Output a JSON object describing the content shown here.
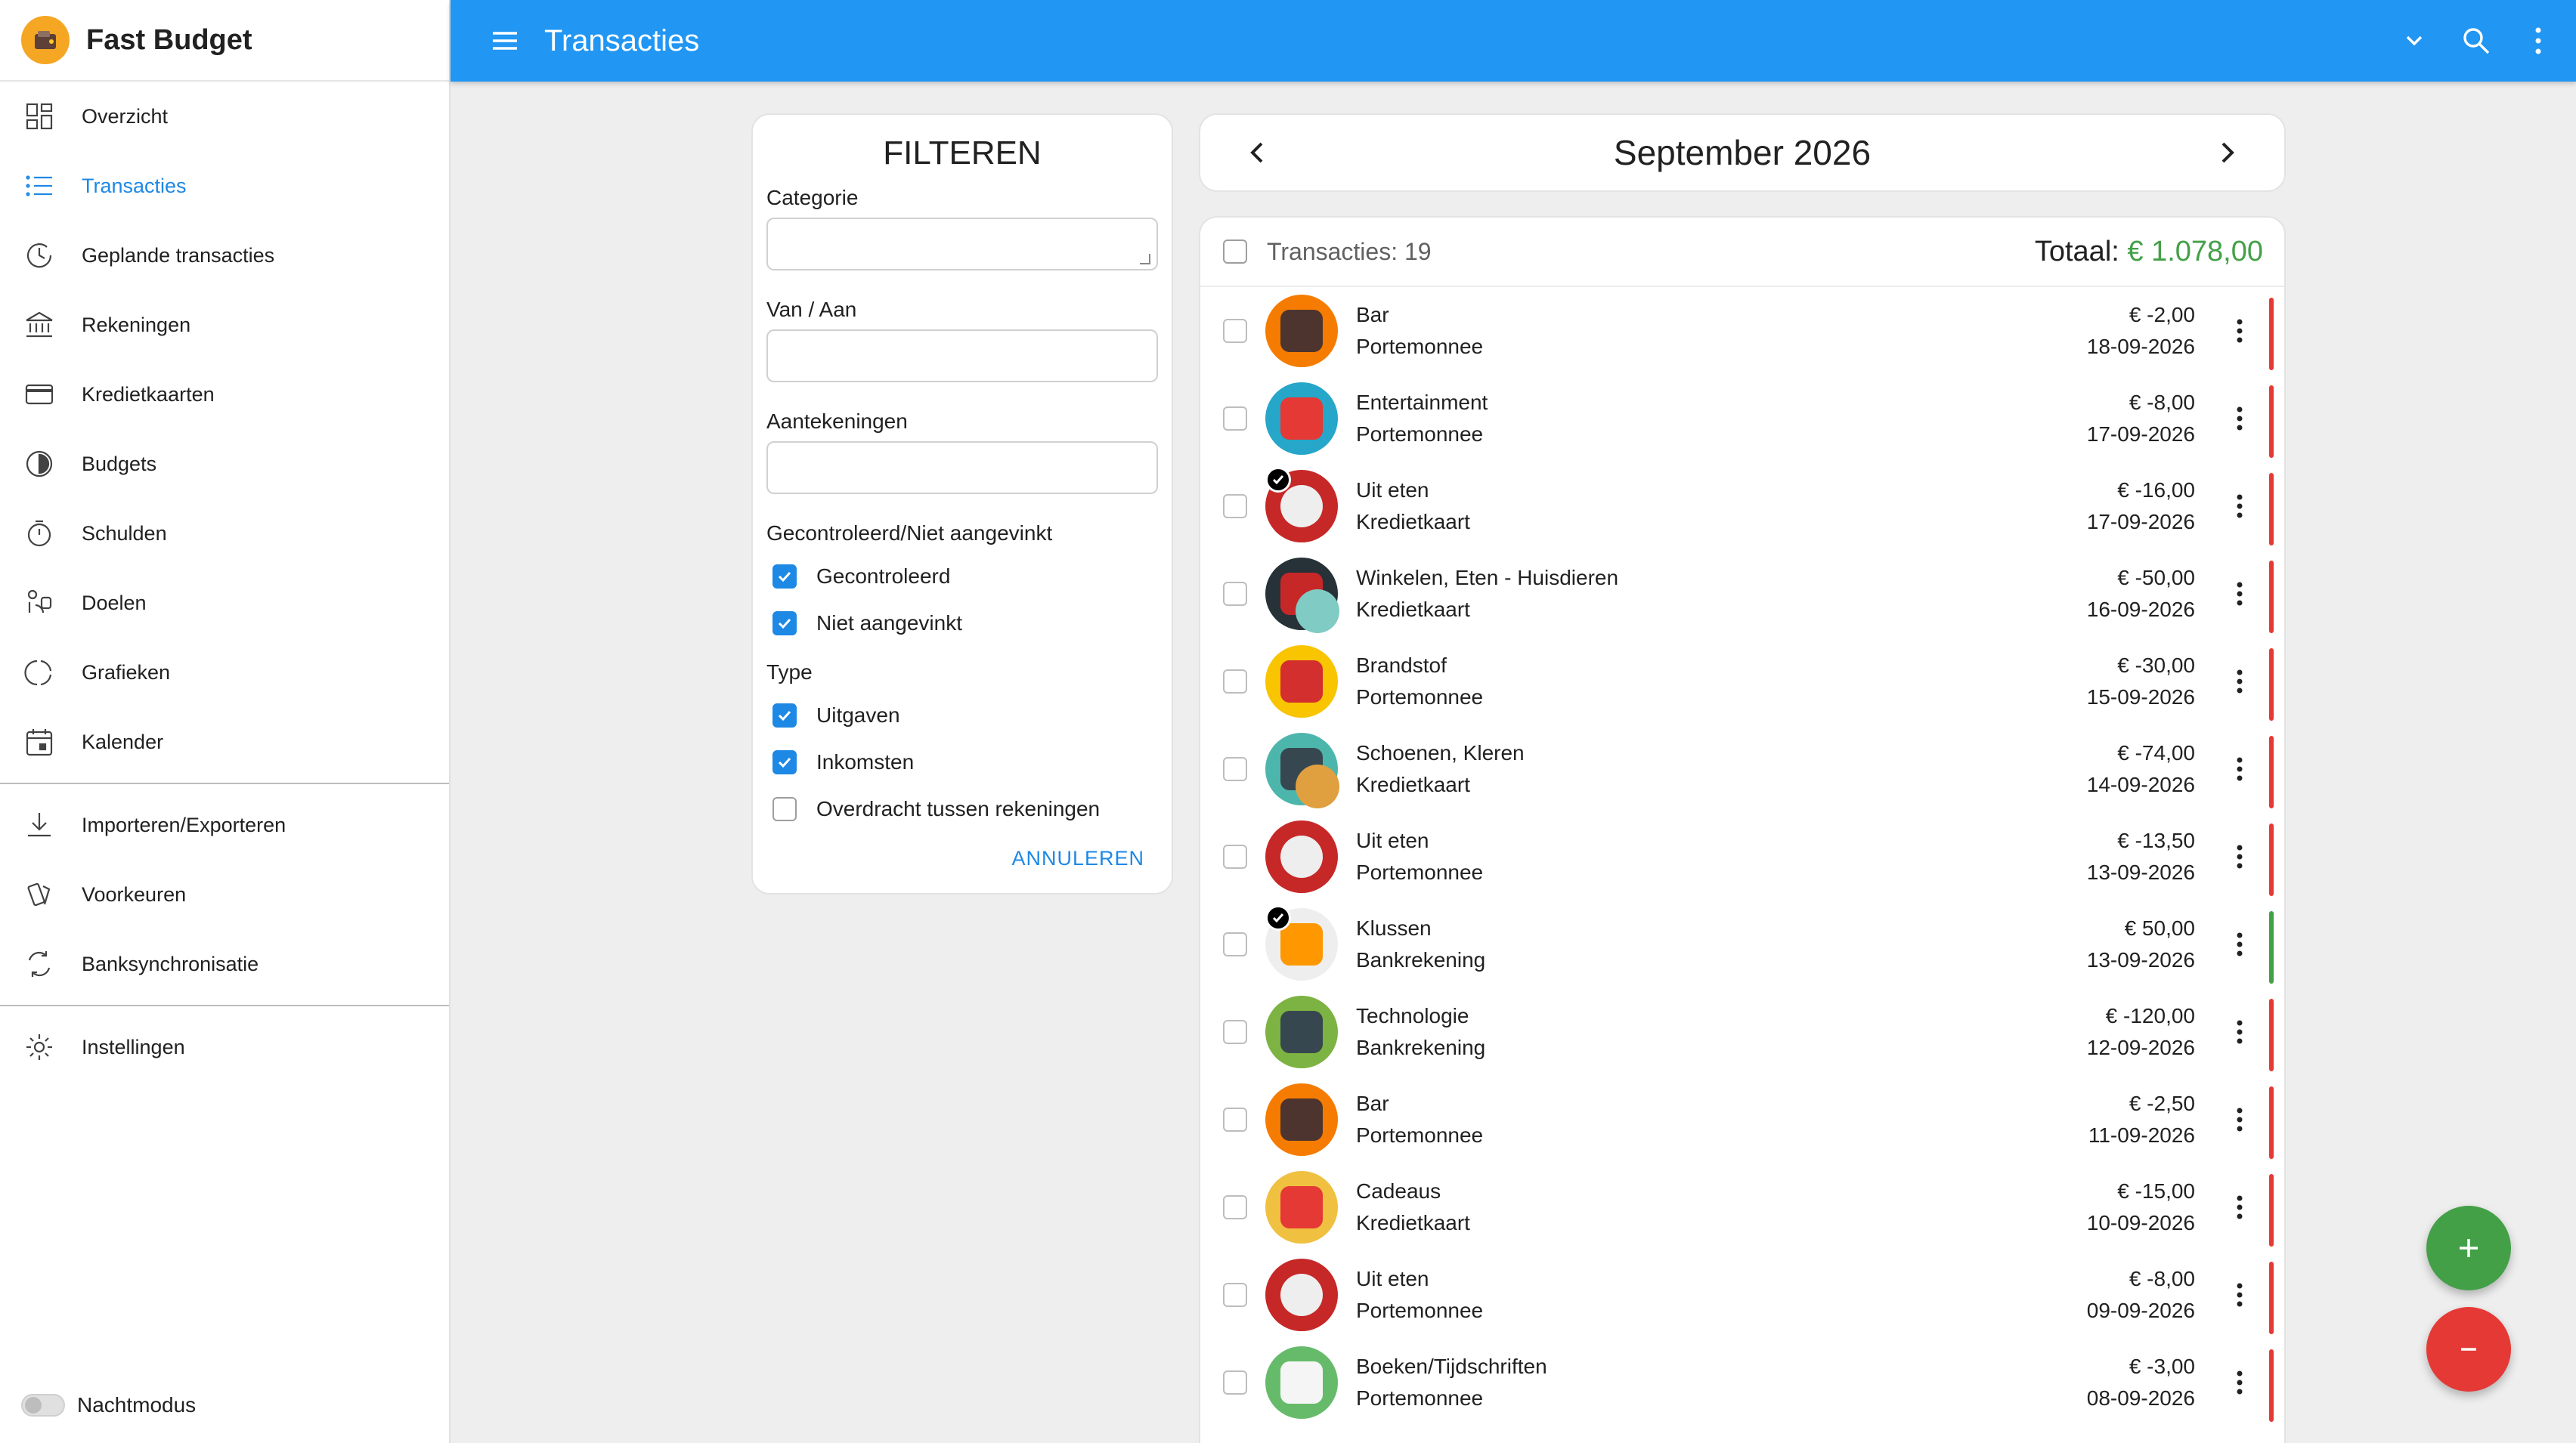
{
  "app": {
    "name": "Fast Budget",
    "accent": "#2196f3"
  },
  "sidebar": {
    "items": [
      {
        "label": "Overzicht",
        "icon": "dashboard-icon"
      },
      {
        "label": "Transacties",
        "icon": "list-icon",
        "active": true
      },
      {
        "label": "Geplande transacties",
        "icon": "schedule-icon"
      },
      {
        "label": "Rekeningen",
        "icon": "bank-icon"
      },
      {
        "label": "Kredietkaarten",
        "icon": "credit-card-icon"
      },
      {
        "label": "Budgets",
        "icon": "pie-icon"
      },
      {
        "label": "Schulden",
        "icon": "timer-icon"
      },
      {
        "label": "Doelen",
        "icon": "goal-icon"
      },
      {
        "label": "Grafieken",
        "icon": "donut-icon"
      },
      {
        "label": "Kalender",
        "icon": "calendar-icon"
      }
    ],
    "items2": [
      {
        "label": "Importeren/Exporteren",
        "icon": "download-icon"
      },
      {
        "label": "Voorkeuren",
        "icon": "preferences-icon"
      },
      {
        "label": "Banksynchronisatie",
        "icon": "sync-icon"
      }
    ],
    "items3": [
      {
        "label": "Instellingen",
        "icon": "settings-icon"
      }
    ],
    "night_mode": "Nachtmodus"
  },
  "topbar": {
    "title": "Transacties"
  },
  "filter": {
    "title": "FILTEREN",
    "category_label": "Categorie",
    "from_to_label": "Van / Aan",
    "notes_label": "Aantekeningen",
    "checked_section": "Gecontroleerd/Niet aangevinkt",
    "checked": "Gecontroleerd",
    "unchecked": "Niet aangevinkt",
    "type_section": "Type",
    "expenses": "Uitgaven",
    "income": "Inkomsten",
    "transfer": "Overdracht tussen rekeningen",
    "cancel": "ANNULEREN"
  },
  "month": {
    "title": "September 2026"
  },
  "list": {
    "count": "Transacties: 19",
    "total_label": "Totaal:",
    "total_value": "€ 1.078,00",
    "rows": [
      {
        "category": "Bar",
        "account": "Portemonnee",
        "amount": "€ -2,00",
        "date": "18-09-2026",
        "color": "#f57c00",
        "icon": "coffee-icon",
        "inner": "#4e342e",
        "type": "expense"
      },
      {
        "category": "Entertainment",
        "account": "Portemonnee",
        "amount": "€ -8,00",
        "date": "17-09-2026",
        "color": "#26a6c9",
        "icon": "party-hat-icon",
        "inner": "#e53935",
        "type": "expense"
      },
      {
        "category": "Uit eten",
        "account": "Kredietkaart",
        "amount": "€ -16,00",
        "date": "17-09-2026",
        "color": "#c62828",
        "icon": "plate-icon",
        "inner": "#eeeeee",
        "type": "expense",
        "checked": true
      },
      {
        "category": "Winkelen, Eten - Huisdieren",
        "account": "Kredietkaart",
        "amount": "€ -50,00",
        "date": "16-09-2026",
        "color": "#263238",
        "icon": "shopping-icon",
        "inner": "#c62828",
        "type": "expense",
        "sub": "#80cbc4"
      },
      {
        "category": "Brandstof",
        "account": "Portemonnee",
        "amount": "€ -30,00",
        "date": "15-09-2026",
        "color": "#f9c400",
        "icon": "fuel-icon",
        "inner": "#d32f2f",
        "type": "expense"
      },
      {
        "category": "Schoenen, Kleren",
        "account": "Kredietkaart",
        "amount": "€ -74,00",
        "date": "14-09-2026",
        "color": "#4db6ac",
        "icon": "shoe-icon",
        "inner": "#37474f",
        "type": "expense",
        "sub": "#e0a040"
      },
      {
        "category": "Uit eten",
        "account": "Portemonnee",
        "amount": "€ -13,50",
        "date": "13-09-2026",
        "color": "#c62828",
        "icon": "plate-icon",
        "inner": "#eeeeee",
        "type": "expense"
      },
      {
        "category": "Klussen",
        "account": "Bankrekening",
        "amount": "€ 50,00",
        "date": "13-09-2026",
        "color": "#eeeeee",
        "icon": "tools-icon",
        "inner": "#ff9800",
        "type": "income",
        "checked": true
      },
      {
        "category": "Technologie",
        "account": "Bankrekening",
        "amount": "€ -120,00",
        "date": "12-09-2026",
        "color": "#7cb342",
        "icon": "hard-drive-icon",
        "inner": "#37474f",
        "type": "expense"
      },
      {
        "category": "Bar",
        "account": "Portemonnee",
        "amount": "€ -2,50",
        "date": "11-09-2026",
        "color": "#f57c00",
        "icon": "coffee-icon",
        "inner": "#4e342e",
        "type": "expense"
      },
      {
        "category": "Cadeaus",
        "account": "Kredietkaart",
        "amount": "€ -15,00",
        "date": "10-09-2026",
        "color": "#f0c040",
        "icon": "gift-icon",
        "inner": "#e53935",
        "type": "expense"
      },
      {
        "category": "Uit eten",
        "account": "Portemonnee",
        "amount": "€ -8,00",
        "date": "09-09-2026",
        "color": "#c62828",
        "icon": "plate-icon",
        "inner": "#eeeeee",
        "type": "expense"
      },
      {
        "category": "Boeken/Tijdschriften",
        "account": "Portemonnee",
        "amount": "€ -3,00",
        "date": "08-09-2026",
        "color": "#66bb6a",
        "icon": "newspaper-icon",
        "inner": "#f5f5f5",
        "type": "expense"
      }
    ]
  },
  "colors": {
    "expense": "#e53935",
    "income": "#43a047"
  }
}
